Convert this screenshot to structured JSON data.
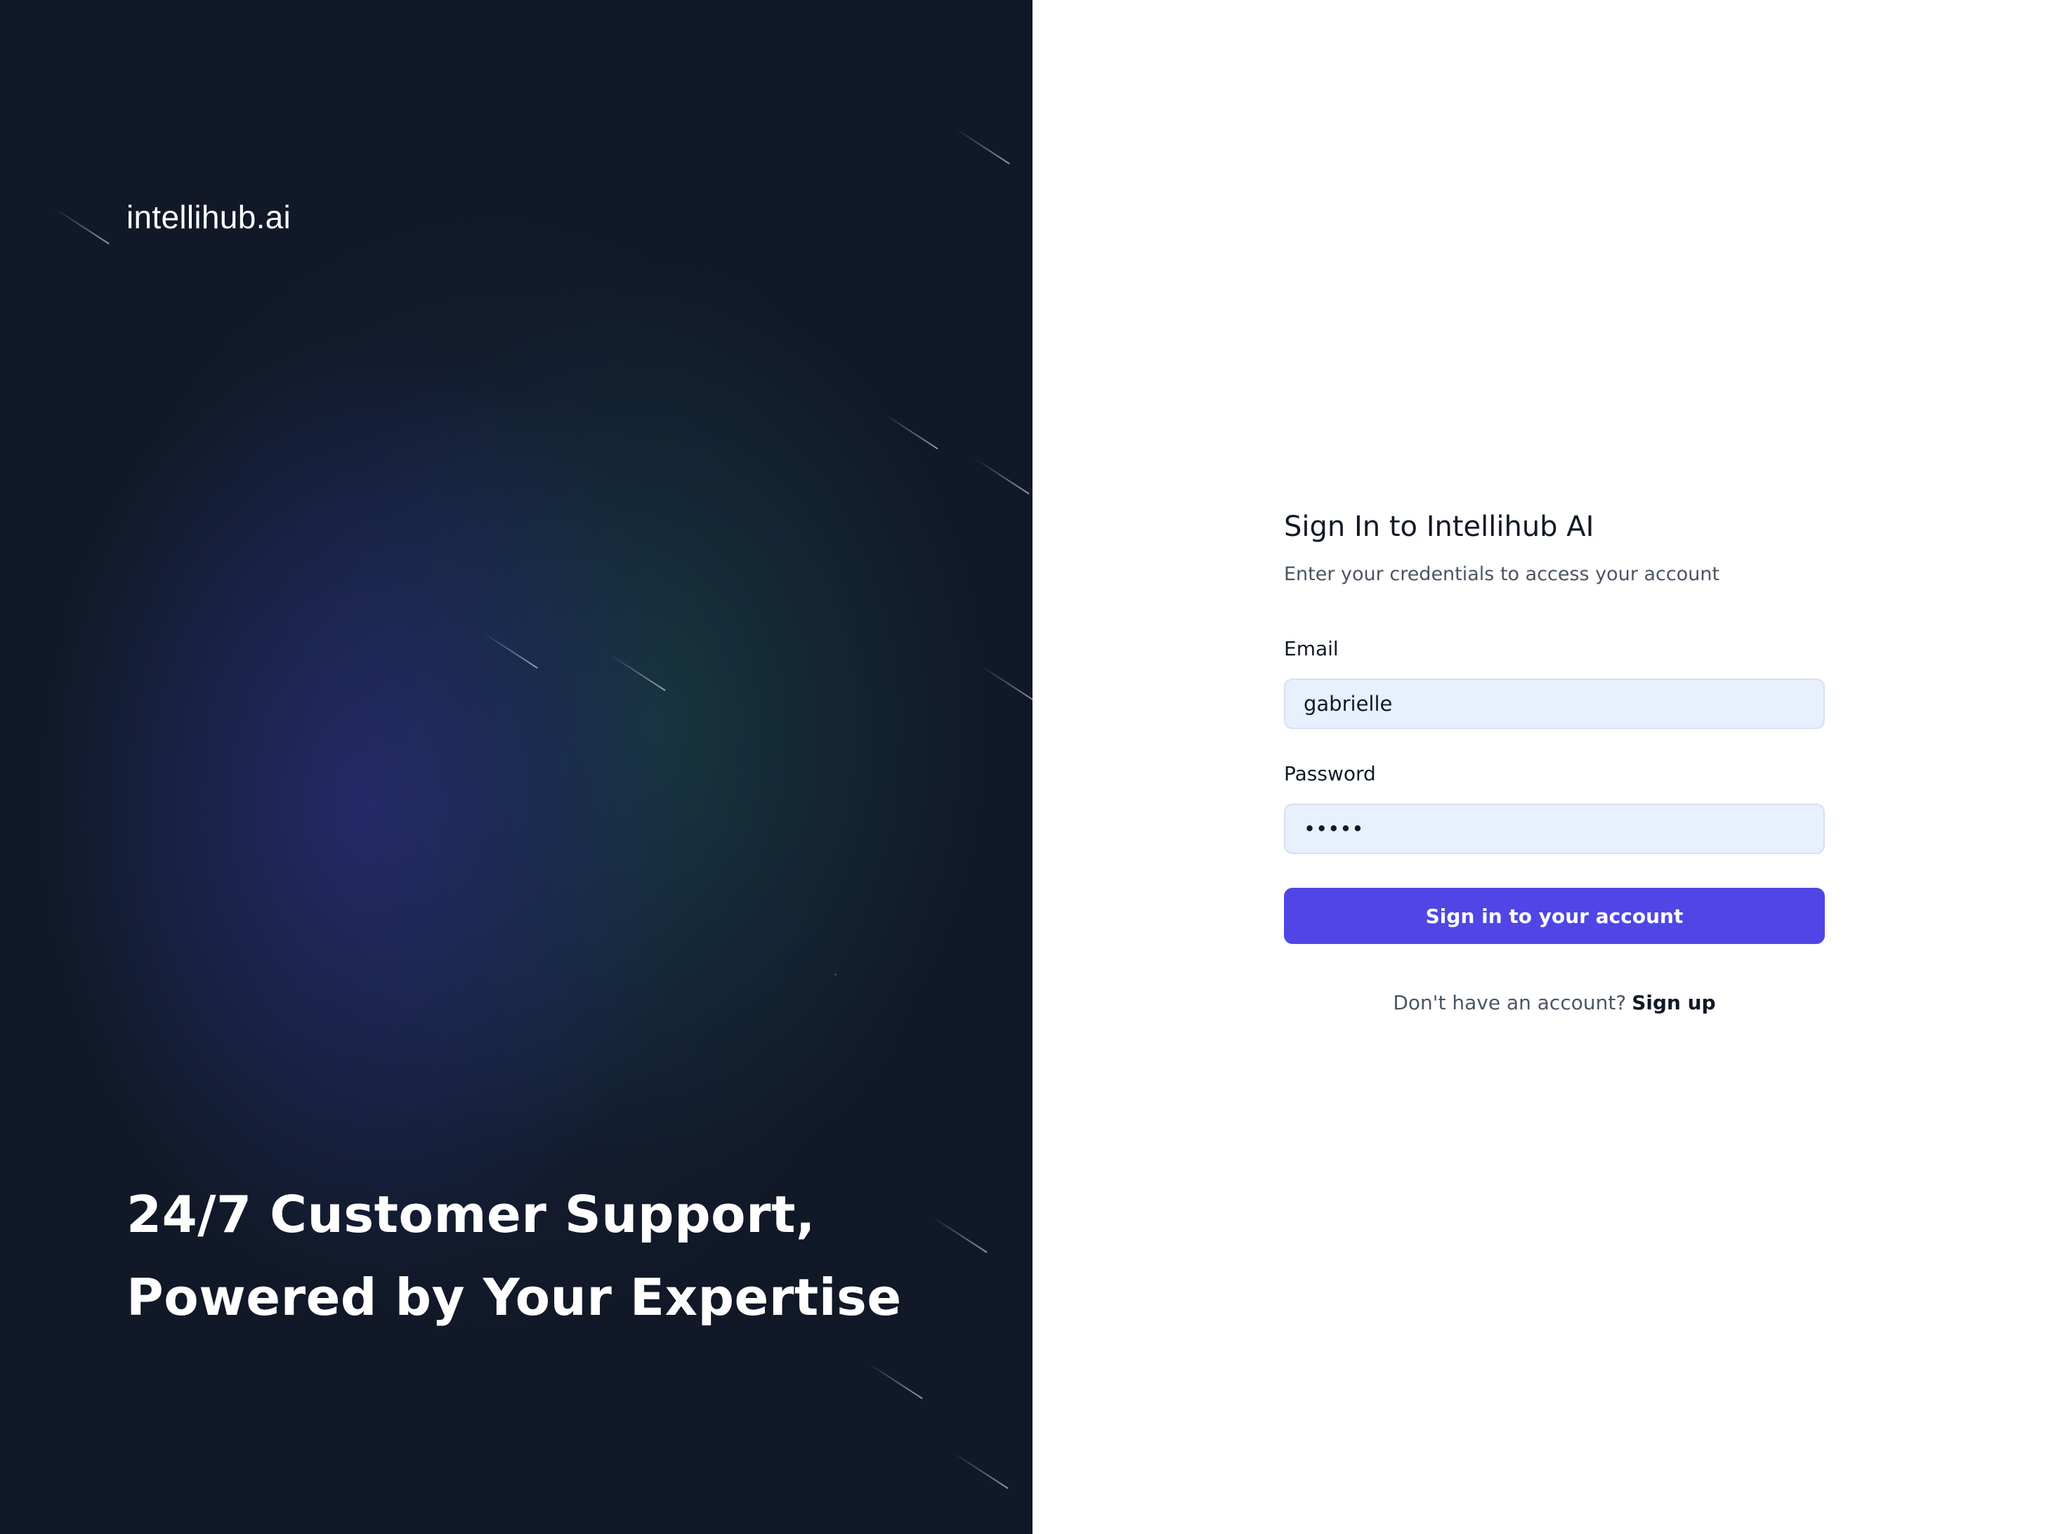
{
  "hero": {
    "brand": "intellihub.ai",
    "tagline_line1": "24/7 Customer Support,",
    "tagline_line2": "Powered by Your Expertise"
  },
  "form": {
    "title": "Sign In to Intellihub AI",
    "subtitle": "Enter your credentials to access your account",
    "email_label": "Email",
    "email_value": "gabrielle",
    "password_label": "Password",
    "password_value": "•••••",
    "submit_label": "Sign in to your account",
    "signup_prompt": "Don't have an account?",
    "signup_link": "Sign up"
  },
  "colors": {
    "hero_background": "#111827",
    "primary_button": "#4f46e5",
    "input_background": "#e8f0fe"
  }
}
